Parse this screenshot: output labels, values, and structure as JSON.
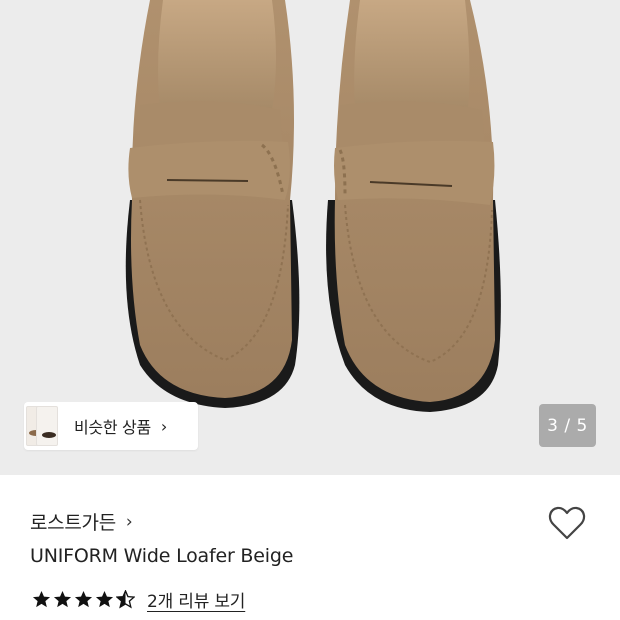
{
  "product_image": {
    "counter": "3 / 5"
  },
  "similar": {
    "label": "비슷한 상품",
    "chevron": "›"
  },
  "brand": {
    "name": "로스트가든",
    "chevron": "›"
  },
  "product": {
    "name": "UNIFORM Wide Loafer Beige",
    "rating": 4.5,
    "review_link": "2개 리뷰 보기"
  },
  "icons": [
    "heart-icon",
    "star-icon",
    "chevron-right-icon"
  ],
  "colors": {
    "background": "#ececec",
    "suede": "#a88a68",
    "text": "#222222",
    "counter_bg": "#969696"
  }
}
